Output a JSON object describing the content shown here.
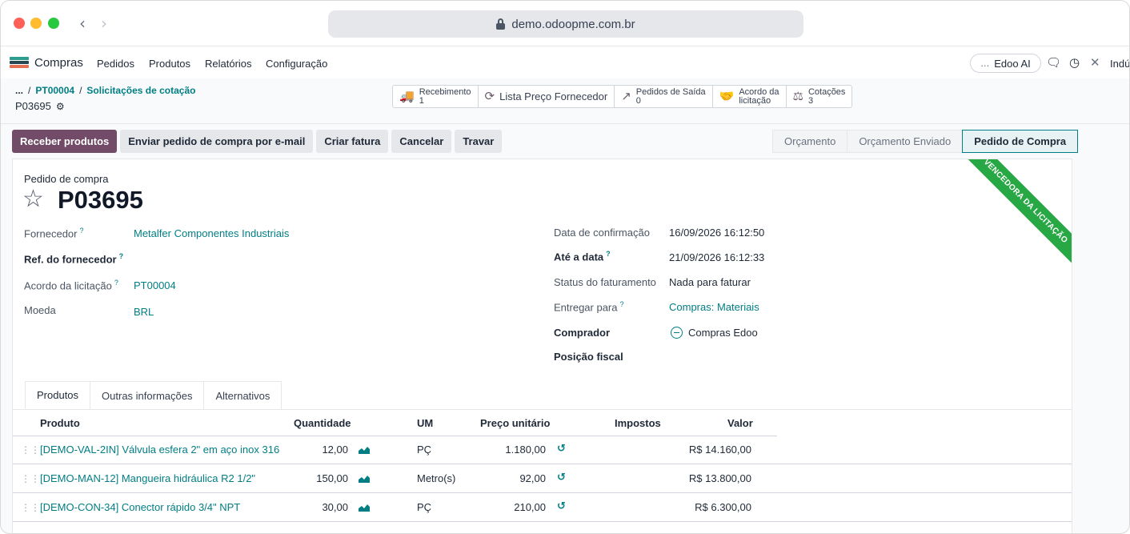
{
  "browser": {
    "url": "demo.odoopme.com.br",
    "back_icon": "‹",
    "forward_icon": "›"
  },
  "topnav": {
    "app_title": "Compras",
    "menu": [
      "Pedidos",
      "Produtos",
      "Relatórios",
      "Configuração"
    ],
    "edoo_label": "Edoo AI",
    "company": "Indú",
    "app_icon_colors": [
      "#2a9d8f",
      "#264653",
      "#e76f51"
    ]
  },
  "breadcrumb": {
    "ellipsis": "...",
    "items": [
      "PT00004",
      "Solicitações de cotação"
    ],
    "current": "P03695"
  },
  "smart_buttons": [
    {
      "label": "Recebimento",
      "value": "1",
      "icon": "truck-icon"
    },
    {
      "label": "Lista Preço Fornecedor",
      "value": "",
      "icon": "refresh-icon"
    },
    {
      "label": "Pedidos de Saída",
      "value": "0",
      "icon": "arrow-out-icon"
    },
    {
      "label": "Acordo da",
      "value": "licitação",
      "icon": "handshake-icon"
    },
    {
      "label": "Cotações",
      "value": "3",
      "icon": "scale-icon"
    }
  ],
  "actions": {
    "receive": "Receber produtos",
    "email": "Enviar pedido de compra por e-mail",
    "invoice": "Criar fatura",
    "cancel": "Cancelar",
    "lock": "Travar"
  },
  "status": {
    "stages": [
      "Orçamento",
      "Orçamento Enviado",
      "Pedido de Compra"
    ],
    "active": "Pedido de Compra"
  },
  "ribbon": "VENCEDORA DA LICITAÇÃO",
  "form": {
    "doc_type": "Pedido de compra",
    "doc_name": "P03695",
    "left": {
      "vendor_label": "Fornecedor",
      "vendor_value": "Metalfer Componentes Industriais",
      "vendor_ref_label": "Ref. do fornecedor",
      "agreement_label": "Acordo da licitação",
      "agreement_value": "PT00004",
      "currency_label": "Moeda",
      "currency_value": "BRL"
    },
    "right": {
      "confirm_label": "Data de confirmação",
      "confirm_value": "16/09/2026 16:12:50",
      "deadline_label": "Até a data",
      "deadline_value": "21/09/2026 16:12:33",
      "billing_label": "Status do faturamento",
      "billing_value": "Nada para faturar",
      "deliver_label": "Entregar para",
      "deliver_value": "Compras: Materiais",
      "buyer_label": "Comprador",
      "buyer_value": "Compras Edoo",
      "fiscal_label": "Posição fiscal"
    },
    "help_mark": "?"
  },
  "tabs": [
    "Produtos",
    "Outras informações",
    "Alternativos"
  ],
  "table": {
    "headers": {
      "product": "Produto",
      "qty": "Quantidade",
      "uom": "UM",
      "price": "Preço unitário",
      "taxes": "Impostos",
      "amount": "Valor"
    },
    "rows": [
      {
        "product": "[DEMO-VAL-2IN] Válvula esfera 2\" em aço inox 316",
        "qty": "12,00",
        "uom": "PÇ",
        "price": "1.180,00",
        "amount": "R$ 14.160,00"
      },
      {
        "product": "[DEMO-MAN-12] Mangueira hidráulica R2 1/2\"",
        "qty": "150,00",
        "uom": "Metro(s)",
        "price": "92,00",
        "amount": "R$ 13.800,00"
      },
      {
        "product": "[DEMO-CON-34] Conector rápido 3/4\" NPT",
        "qty": "30,00",
        "uom": "PÇ",
        "price": "210,00",
        "amount": "R$ 6.300,00"
      }
    ]
  }
}
